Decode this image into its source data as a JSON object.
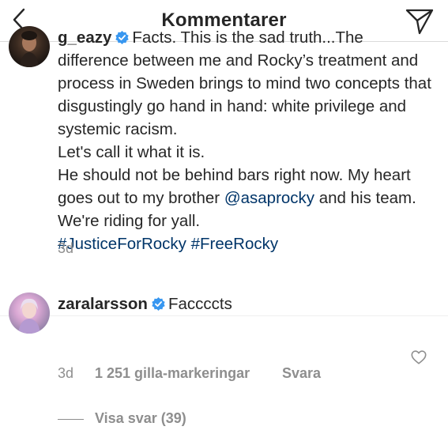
{
  "header": {
    "title": "Kommentarer",
    "back_icon": "chevron-left-icon",
    "send_icon": "paper-plane-icon"
  },
  "comments": [
    {
      "username": "g_eazy",
      "verified": true,
      "text_parts": [
        "Facts. This is the sad truth...The difference between me and Rocky’s treatment and process in Sweden brings to mind two concepts that disgustingly go hand in hand: white privilege and systemic racism.",
        "Let's call it what it is.",
        "He should not be behind bars right now. My heart goes out to my brother ",
        "@asaprocky",
        " and his team. We're riding for yall.",
        "#JusticeForRocky",
        "#FreeRocky"
      ],
      "time": "3d"
    },
    {
      "username": "zaralarsson",
      "verified": true,
      "text": "Faccccts",
      "time": "3d",
      "likes": "1 251 gilla-markeringar",
      "reply_label": "Svara",
      "view_replies": "Visa svar (39)"
    }
  ],
  "colors": {
    "text": "#262626",
    "muted": "#8e8e8e",
    "link": "#003569",
    "verified": "#3897f0"
  }
}
